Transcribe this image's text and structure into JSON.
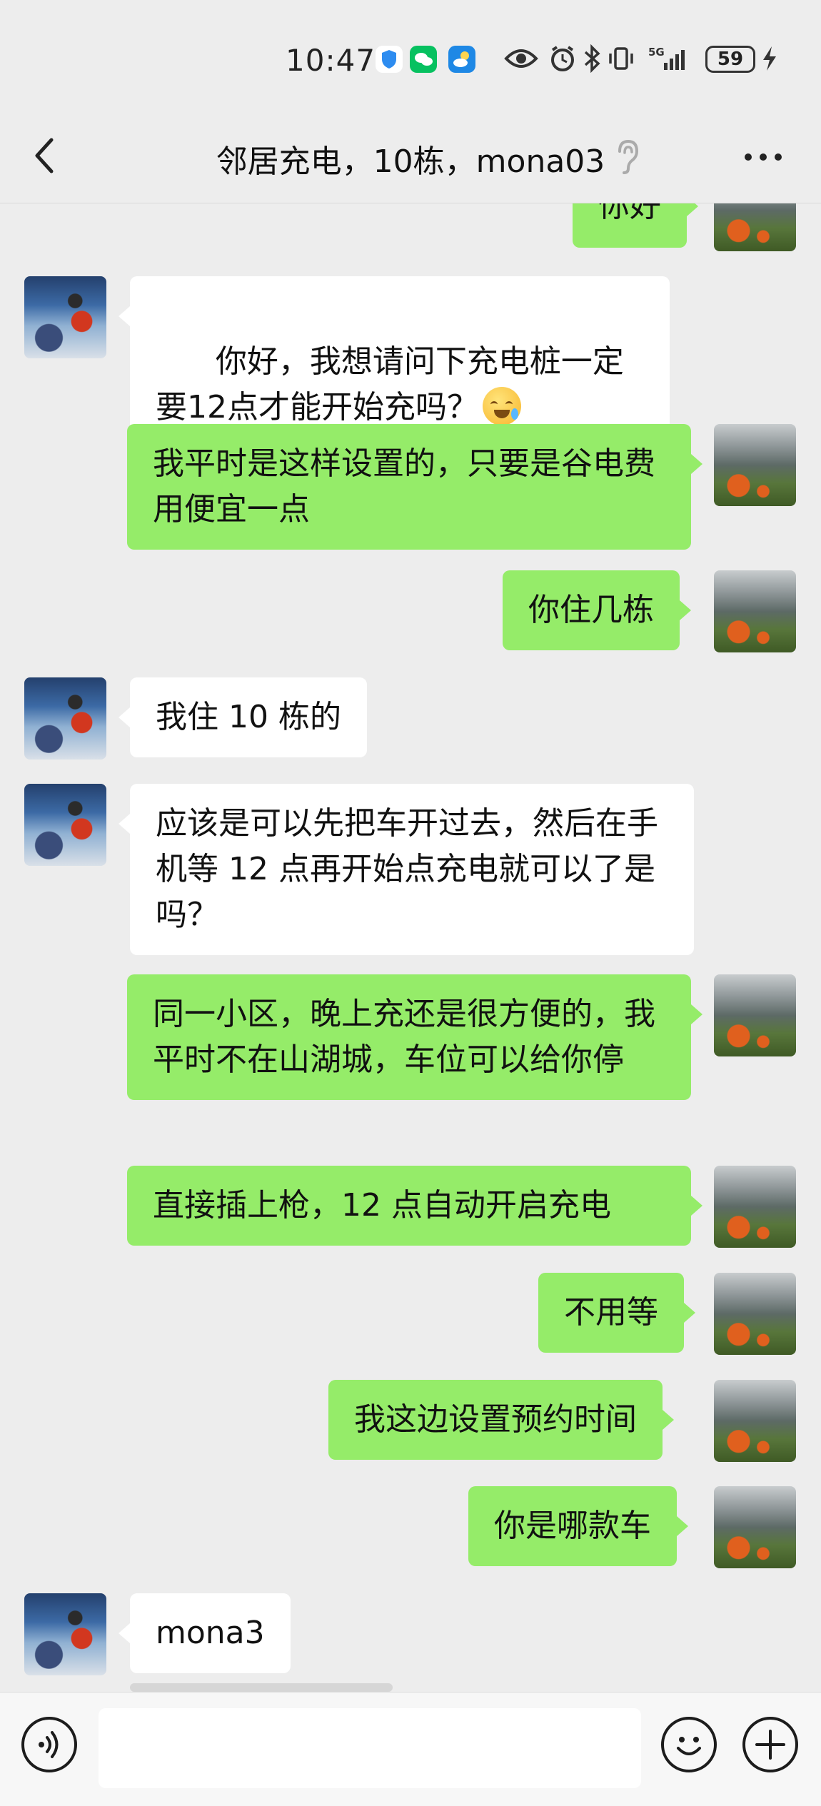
{
  "status_bar": {
    "time": "10:47",
    "battery": "59",
    "signal": "5G"
  },
  "header": {
    "back_icon": "chevron-left-icon",
    "title": "邻居充电，10栋，mona03",
    "ear_icon": "ear-icon",
    "more_icon": "more-dots-icon"
  },
  "messages": [
    {
      "side": "right",
      "text": "你好"
    },
    {
      "side": "left",
      "text": "你好，我想请问下充电桩一定要12点才能开始充吗？",
      "emoji": "laughing-crying-emoji"
    },
    {
      "side": "right",
      "text": "我平时是这样设置的，只要是谷电费用便宜一点"
    },
    {
      "side": "right",
      "text": "你住几栋"
    },
    {
      "side": "left",
      "text": "我住 10 栋的"
    },
    {
      "side": "left",
      "text": "应该是可以先把车开过去，然后在手机等 12 点再开始点充电就可以了是吗？"
    },
    {
      "side": "right",
      "text": "同一小区，晚上充还是很方便的，我平时不在山湖城，车位可以给你停"
    },
    {
      "side": "right",
      "text": "直接插上枪，12 点自动开启充电"
    },
    {
      "side": "right",
      "text": "不用等"
    },
    {
      "side": "right",
      "text": "我这边设置预约时间"
    },
    {
      "side": "right",
      "text": "你是哪款车"
    },
    {
      "side": "left",
      "text": "mona3"
    }
  ],
  "input_bar": {
    "voice_icon": "voice-icon",
    "input_value": "",
    "emoji_icon": "emoji-icon",
    "plus_icon": "plus-icon"
  },
  "colors": {
    "background": "#ededed",
    "sent_bubble": "#95ec69",
    "received_bubble": "#ffffff"
  }
}
